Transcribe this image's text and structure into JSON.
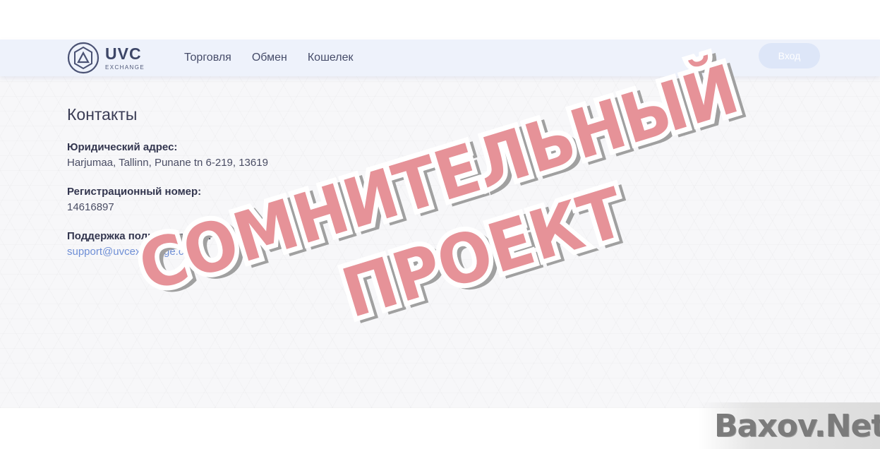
{
  "header": {
    "logo": {
      "name": "UVC",
      "subtitle": "EXCHANGE"
    },
    "nav": [
      "Торговля",
      "Обмен",
      "Кошелек"
    ],
    "login_label": "Вход"
  },
  "page": {
    "title": "Контакты",
    "fields": [
      {
        "label": "Юридический адрес:",
        "value": "Harjumaa, Tallinn, Punane tn 6-219, 13619"
      },
      {
        "label": "Регистрационный номер:",
        "value": "14616897"
      },
      {
        "label": "Поддержка пользователей:",
        "value": "support@uvcexchange.com"
      }
    ]
  },
  "stamp": {
    "line1": "СОМНИТЕЛЬНЫЙ",
    "line2": "ПРОЕКТ",
    "color": "#e27f86"
  },
  "watermark": "Baxov.Net",
  "colors": {
    "header_bg": "#eef2fb",
    "link": "#6f8fd6",
    "login_bg": "#dde6f8"
  }
}
